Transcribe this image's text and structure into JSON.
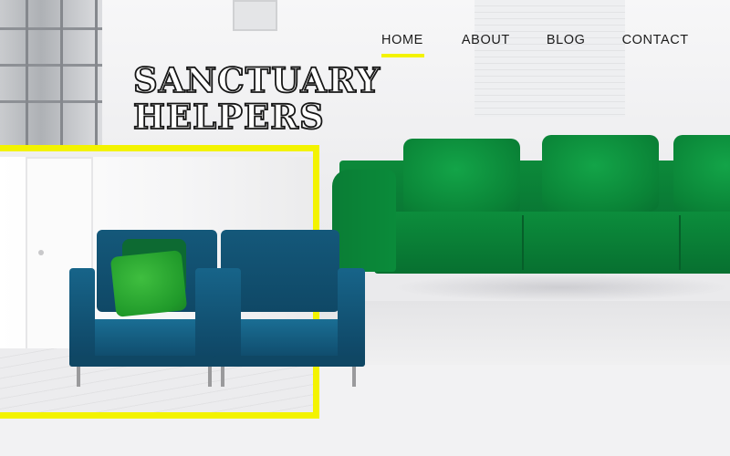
{
  "brand": {
    "logo_text": "SANCTUARY\nHELPERS"
  },
  "nav": {
    "items": [
      {
        "label": "HOME",
        "active": true
      },
      {
        "label": "ABOUT",
        "active": false
      },
      {
        "label": "BLOG",
        "active": false
      },
      {
        "label": "CONTACT",
        "active": false
      }
    ]
  },
  "colors": {
    "accent_yellow": "#f3f300",
    "sofa_green": "#0a8b3a",
    "chair_blue": "#14587a",
    "text_dark": "#1b1b1b"
  }
}
